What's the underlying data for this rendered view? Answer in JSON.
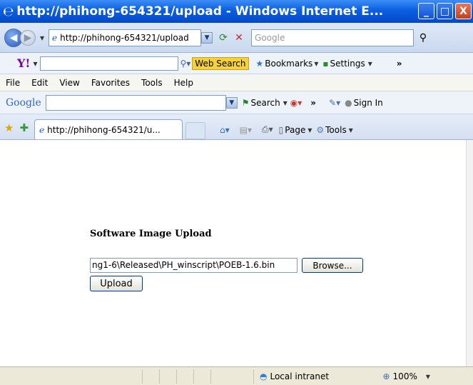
{
  "window": {
    "title": "http://phihong-654321/upload - Windows Internet E...",
    "minimize_glyph": "_",
    "maximize_glyph": "□",
    "close_glyph": "X"
  },
  "address_bar": {
    "url": "http://phihong-654321/upload",
    "search_placeholder": "Google"
  },
  "yahoo_toolbar": {
    "logo": "Y!",
    "web_search_label": "Web Search",
    "bookmarks_label": "Bookmarks",
    "settings_label": "Settings"
  },
  "menu": {
    "items": [
      "File",
      "Edit",
      "View",
      "Favorites",
      "Tools",
      "Help"
    ]
  },
  "google_toolbar": {
    "logo": "Google",
    "search_label": "Search",
    "sign_in_label": "Sign In"
  },
  "tabs": {
    "active_tab_label": "http://phihong-654321/u...",
    "page_label": "Page",
    "tools_label": "Tools"
  },
  "page": {
    "heading": "Software Image Upload",
    "file_value": "ng1-6\\Released\\PH_winscript\\POEB-1.6.bin",
    "browse_label": "Browse...",
    "upload_label": "Upload"
  },
  "status": {
    "zone": "Local intranet",
    "zoom": "100%"
  }
}
